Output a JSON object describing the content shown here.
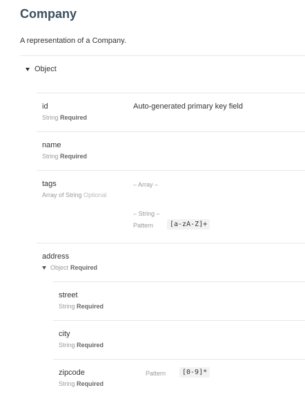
{
  "schema": {
    "title": "Company",
    "description": "A representation of a Company.",
    "object_label": "Object"
  },
  "fields": {
    "id": {
      "name": "id",
      "type": "String",
      "req": "Required",
      "desc": "Auto-generated primary key field"
    },
    "name": {
      "name": "name",
      "type": "String",
      "req": "Required"
    },
    "tags": {
      "name": "tags",
      "type": "Array of String",
      "req": "Optional",
      "array_label": "– Array –",
      "string_label": "– String –",
      "pattern_label": "Pattern",
      "pattern": "[a-zA-Z]+"
    },
    "address": {
      "name": "address",
      "type": "Object",
      "req": "Required",
      "street": {
        "name": "street",
        "type": "String",
        "req": "Required"
      },
      "city": {
        "name": "city",
        "type": "String",
        "req": "Required"
      },
      "zipcode": {
        "name": "zipcode",
        "type": "String",
        "req": "Required",
        "pattern_label": "Pattern",
        "pattern": "[0-9]*"
      }
    }
  }
}
